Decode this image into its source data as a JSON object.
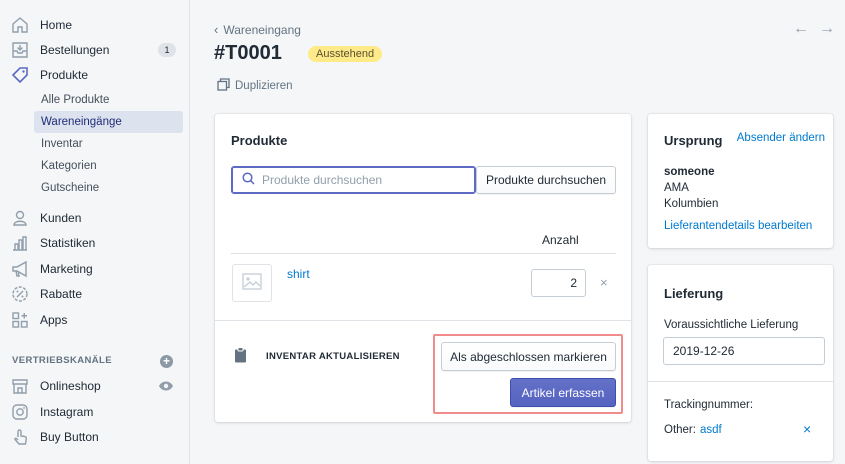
{
  "sidebar": {
    "items": [
      {
        "label": "Home",
        "icon": "home-icon"
      },
      {
        "label": "Bestellungen",
        "icon": "orders-icon",
        "badge": "1"
      },
      {
        "label": "Produkte",
        "icon": "tag-icon"
      },
      {
        "label": "Kunden",
        "icon": "person-icon"
      },
      {
        "label": "Statistiken",
        "icon": "bar-chart-icon"
      },
      {
        "label": "Marketing",
        "icon": "megaphone-icon"
      },
      {
        "label": "Rabatte",
        "icon": "discount-icon"
      },
      {
        "label": "Apps",
        "icon": "apps-icon"
      }
    ],
    "subitems": [
      "Alle Produkte",
      "Wareneingänge",
      "Inventar",
      "Kategorien",
      "Gutscheine"
    ],
    "channels_header": "VERTRIEBSKANÄLE",
    "channels": [
      {
        "label": "Onlineshop",
        "icon": "store-icon"
      },
      {
        "label": "Instagram",
        "icon": "instagram-icon"
      },
      {
        "label": "Buy Button",
        "icon": "buy-button-icon"
      }
    ]
  },
  "header": {
    "breadcrumb": "Wareneingang",
    "title": "#T0001",
    "status": "Ausstehend",
    "duplicate": "Duplizieren"
  },
  "products": {
    "title": "Produkte",
    "search_placeholder": "Produkte durchsuchen",
    "search_button": "Produkte durchsuchen",
    "qty_header": "Anzahl",
    "item_name": "shirt",
    "item_qty": "2",
    "inventory_label": "INVENTAR AKTUALISIEREN",
    "mark_complete": "Als abgeschlossen markieren",
    "receive_items": "Artikel erfassen"
  },
  "origin": {
    "title": "Ursprung",
    "change_link": "Absender ändern",
    "name": "someone",
    "line1": "AMA",
    "line2": "Kolumbien",
    "edit_link": "Lieferantendetails bearbeiten"
  },
  "delivery": {
    "title": "Lieferung",
    "expected_label": "Voraussichtliche Lieferung",
    "expected_value": "2019-12-26",
    "tracking_label": "Trackingnummer:",
    "other_label": "Other:",
    "other_value": "asdf"
  },
  "colors": {
    "accent": "#5c6ac4",
    "link": "#007ace",
    "status_bg": "#ffea8a",
    "highlight": "#f08c8c"
  }
}
